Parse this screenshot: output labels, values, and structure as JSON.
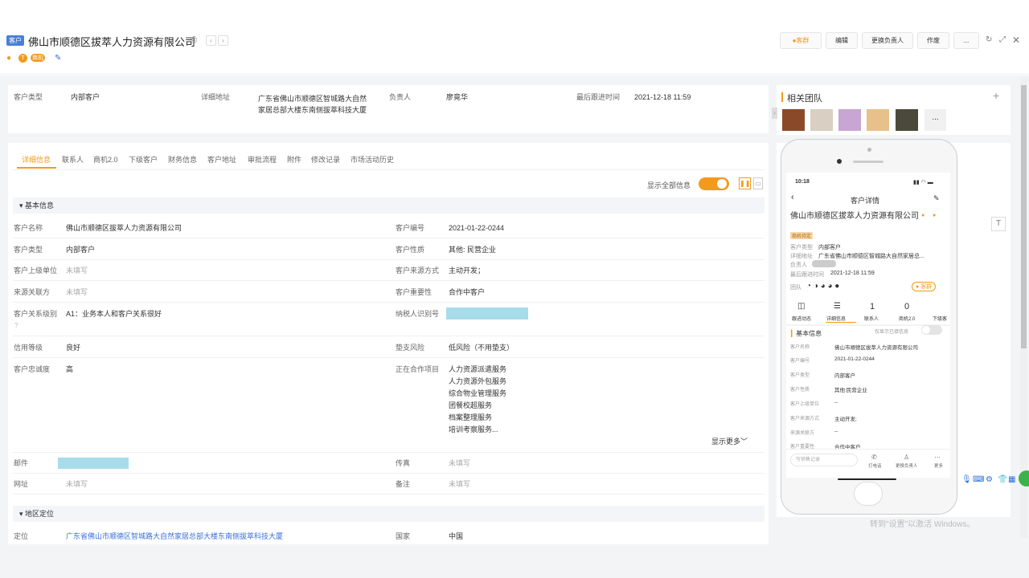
{
  "header": {
    "tag": "客户",
    "title": "佛山市顺德区拔萃人力资源有限公司",
    "badge": "商机",
    "group_btn": "客群",
    "edit_btn": "编辑",
    "change_btn": "更换负责人",
    "void_btn": "作废",
    "more_btn": "..."
  },
  "summary": {
    "type_label": "客户类型",
    "type_value": "内部客户",
    "addr_label": "详细地址",
    "addr_value": "广东省佛山市顺德区智城路大自然家居总部大楼东南侧拔萃科技大厦",
    "owner_label": "负责人",
    "owner_value": "廖竟华",
    "last_label": "最后跟进时间",
    "last_value": "2021-12-18 11:59"
  },
  "tabs": [
    "详细信息",
    "联系人",
    "商机2.0",
    "下级客户",
    "财务信息",
    "客户地址",
    "审批流程",
    "附件",
    "修改记录",
    "市场活动历史"
  ],
  "show_all": "显示全部信息",
  "basic": {
    "title": "基本信息",
    "rows": [
      {
        "l": "客户名称",
        "v": "佛山市顺德区拔萃人力资源有限公司",
        "l2": "客户编号",
        "v2": "2021-01-22-0244"
      },
      {
        "l": "客户类型",
        "v": "内部客户",
        "l2": "客户性质",
        "v2": "其他: 民营企业"
      },
      {
        "l": "客户上级单位",
        "v": "未填写",
        "l2": "客户来源方式",
        "v2": "主动开发；"
      },
      {
        "l": "来源关联方",
        "v": "未填写",
        "l2": "客户重要性",
        "v2": "合作中客户"
      },
      {
        "l": "客户关系级别",
        "v": "A1：业务本人和客户关系很好",
        "l2": "纳税人识别号",
        "v2": ""
      },
      {
        "l": "信用等级",
        "v": "良好",
        "l2": "垫支风险",
        "v2": "低风险（不用垫支）"
      },
      {
        "l": "客户忠诚度",
        "v": "高",
        "l2": "正在合作项目",
        "v2": ""
      }
    ],
    "projects": [
      "人力资源派遣服务",
      "人力资源外包服务",
      "综合物业管理服务",
      "团餐校超服务",
      "档案整理服务",
      "培训考察服务..."
    ],
    "show_more": "显示更多",
    "mail_label": "邮件",
    "fax_label": "传真",
    "fax_value": "未填写",
    "web_label": "网址",
    "web_value": "未填写",
    "note_label": "备注",
    "note_value": "未填写"
  },
  "geo": {
    "title": "地区定位",
    "loc_label": "定位",
    "loc_value": "广东省佛山市顺德区智城路大自然家居总部大楼东南侧拔萃科技大厦",
    "country_label": "国家",
    "country_value": "中国"
  },
  "team": {
    "title": "相关团队",
    "more": "..."
  },
  "phone": {
    "time": "10:18",
    "title": "客户详情",
    "name": "佛山市顺德区拔萃人力资源有限公司",
    "badge": "商机待定",
    "r1l": "客户类型",
    "r1v": "内部客户",
    "r2l": "详细地址",
    "r2v": "广东省佛山市顺德区智城路大自然家居总...",
    "r3l": "负责人",
    "r4l": "最后跟进时间",
    "r4v": "2021-12-18 11:59",
    "team_label": "团队",
    "group": "客群",
    "stats": [
      {
        "n": "",
        "l": "跟进动态"
      },
      {
        "n": "",
        "l": "详细信息"
      },
      {
        "n": "1",
        "l": "联系人"
      },
      {
        "n": "0",
        "l": "商机2.0"
      },
      {
        "n": "",
        "l": "下级客"
      }
    ],
    "basic": "基本信息",
    "only_filled": "仅显示已填信息",
    "fields": [
      {
        "l": "客户名称",
        "v": "佛山市顺德区拔萃人力资源有限公司"
      },
      {
        "l": "客户编号",
        "v": "2021-01-22-0244"
      },
      {
        "l": "客户类型",
        "v": "内部客户"
      },
      {
        "l": "客户性质",
        "v": "其他:民营企业"
      },
      {
        "l": "客户上级单位",
        "v": "--"
      },
      {
        "l": "客户来源方式",
        "v": "主动开发;"
      },
      {
        "l": "来源关联方",
        "v": "--"
      },
      {
        "l": "客户重要性",
        "v": "合作中客户"
      }
    ],
    "input_ph": "写销售记录",
    "b1": "打电话",
    "b2": "更换负责人",
    "b3": "更多"
  },
  "watermark": "转到\"设置\"以激活 Windows。"
}
